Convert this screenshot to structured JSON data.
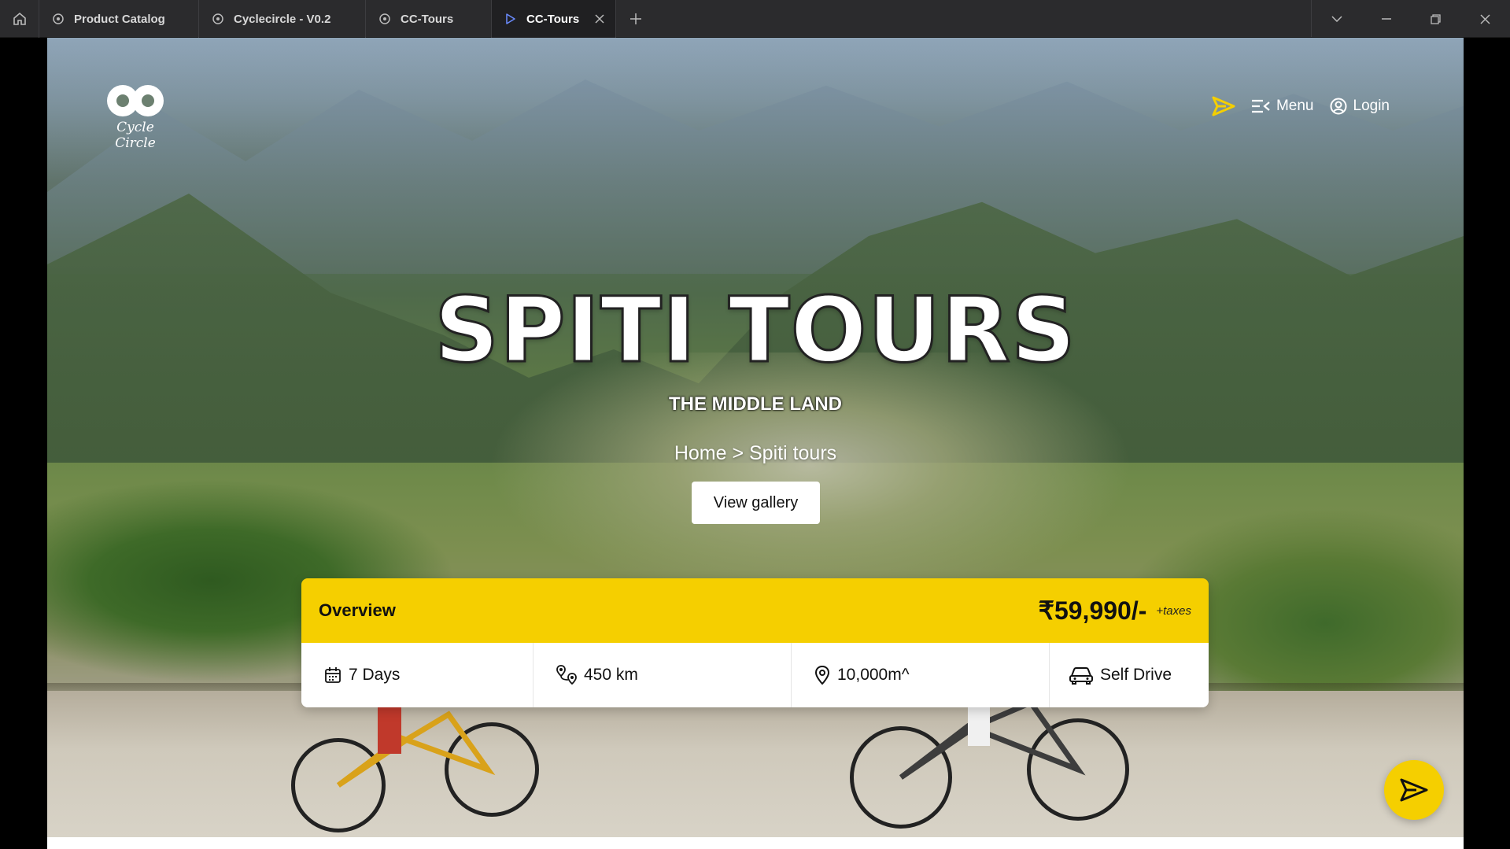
{
  "browser": {
    "tabs": [
      {
        "label": "Product Catalog",
        "icon": "figma-like-icon"
      },
      {
        "label": "Cyclecircle - V0.2",
        "icon": "figma-like-icon"
      },
      {
        "label": "CC-Tours",
        "icon": "figma-like-icon"
      },
      {
        "label": "CC-Tours",
        "icon": "play-icon",
        "active": true
      }
    ]
  },
  "header": {
    "logo_text": "Cycle Circle",
    "menu_label": "Menu",
    "login_label": "Login"
  },
  "hero": {
    "title": "SPITI TOURS",
    "subtitle": "THE MIDDLE LAND",
    "breadcrumb": "Home > Spiti tours",
    "gallery_button": "View gallery"
  },
  "overview": {
    "title": "Overview",
    "price": "₹59,990/-",
    "taxes": "+taxes",
    "stats": [
      {
        "icon": "calendar-icon",
        "label": "7 Days"
      },
      {
        "icon": "route-icon",
        "label": "450 km"
      },
      {
        "icon": "location-pin-icon",
        "label": "10,000m^"
      },
      {
        "icon": "car-icon",
        "label": "Self Drive"
      }
    ]
  },
  "colors": {
    "accent": "#F5CF00",
    "chrome_bg": "#2B2B2D"
  }
}
